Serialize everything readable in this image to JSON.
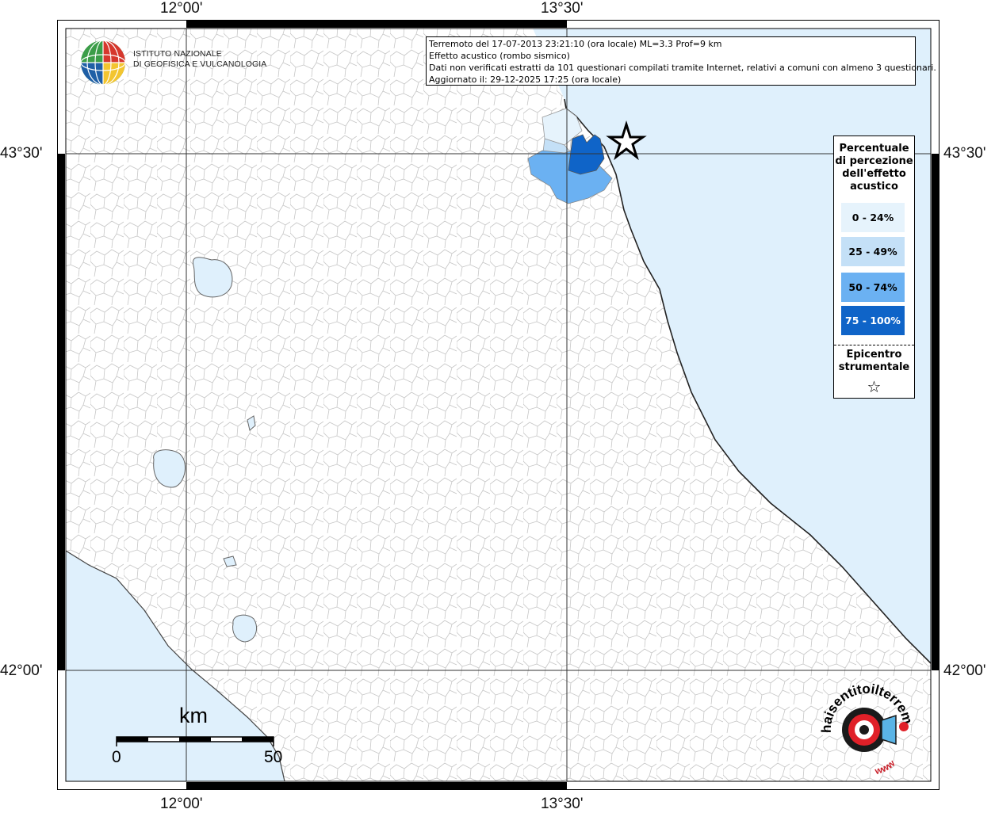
{
  "axes": {
    "lon_labels": [
      "12°00'",
      "13°30'"
    ],
    "lat_labels": [
      "43°30'",
      "42°00'"
    ]
  },
  "info": {
    "line1": "Terremoto del 17-07-2013 23:21:10 (ora locale) ML=3.3 Prof=9 km",
    "line2": "Effetto acustico (rombo sismico)",
    "line3": "Dati non verificati estratti da 101 questionari compilati tramite Internet, relativi a comuni con almeno 3 questionari.",
    "line4": "Aggiornato il: 29-12-2025 17:25 (ora locale)"
  },
  "logo": {
    "line1": "ISTITUTO NAZIONALE",
    "line2": "DI GEOFISICA E VULCANOLOGIA"
  },
  "legend": {
    "title": [
      "Percentuale",
      "di percezione",
      "dell'effetto",
      "acustico"
    ],
    "classes": [
      {
        "label": "0 - 24%",
        "color": "#e6f3fc"
      },
      {
        "label": "25 - 49%",
        "color": "#c4e0f7"
      },
      {
        "label": "50 - 74%",
        "color": "#6bb1f2"
      },
      {
        "label": "75 - 100%",
        "color": "#0f64c8"
      }
    ],
    "epicentro": [
      "Epicentro",
      "strumentale"
    ],
    "star": "☆"
  },
  "scale": {
    "unit": "km",
    "min_label": "0",
    "max_label": "50"
  },
  "colors": {
    "sea": "#dff0fc",
    "land": "#ffffff",
    "border": "#a6a6a6"
  },
  "icons": [
    "ingv-globe-icon",
    "epicenter-star-icon",
    "haisentito-logo-icon"
  ],
  "watermark": {
    "text_top": "haisentitoilterremoto.it",
    "text_bottom": "www"
  }
}
